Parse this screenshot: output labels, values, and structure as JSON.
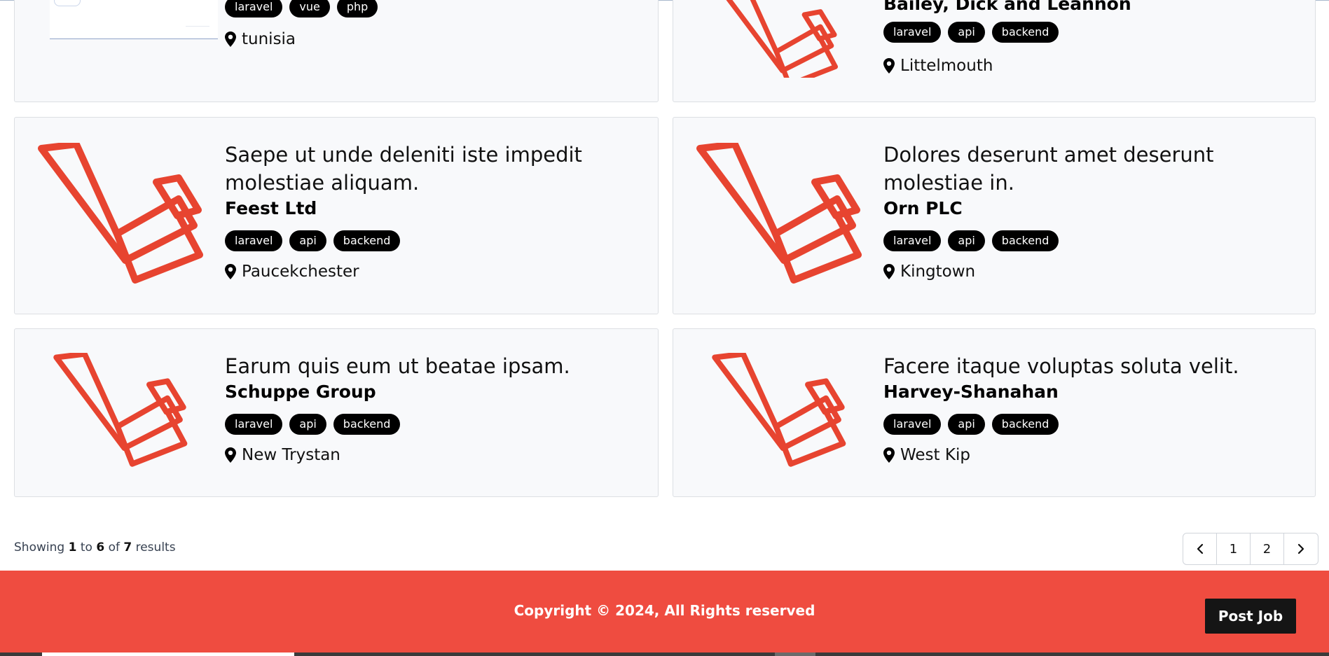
{
  "jobs": [
    {
      "title": "",
      "company": "",
      "tags": [
        "laravel",
        "vue",
        "php"
      ],
      "location": "tunisia",
      "logo": "screenshot-thumbnail"
    },
    {
      "title": "",
      "company": "Bailey, Dick and Leannon",
      "tags": [
        "laravel",
        "api",
        "backend"
      ],
      "location": "Littelmouth",
      "logo": "laravel-logo"
    },
    {
      "title": "Saepe ut unde deleniti iste impedit molestiae aliquam.",
      "company": "Feest Ltd",
      "tags": [
        "laravel",
        "api",
        "backend"
      ],
      "location": "Paucekchester",
      "logo": "laravel-logo"
    },
    {
      "title": "Dolores deserunt amet deserunt molestiae in.",
      "company": "Orn PLC",
      "tags": [
        "laravel",
        "api",
        "backend"
      ],
      "location": "Kingtown",
      "logo": "laravel-logo"
    },
    {
      "title": "Earum quis eum ut beatae ipsam.",
      "company": "Schuppe Group",
      "tags": [
        "laravel",
        "api",
        "backend"
      ],
      "location": "New Trystan",
      "logo": "laravel-logo"
    },
    {
      "title": "Facere itaque voluptas soluta velit.",
      "company": "Harvey-Shanahan",
      "tags": [
        "laravel",
        "api",
        "backend"
      ],
      "location": "West Kip",
      "logo": "laravel-logo"
    }
  ],
  "pagination": {
    "showing_prefix": "Showing",
    "from": "1",
    "to_word": "to",
    "to": "6",
    "of_word": "of",
    "total": "7",
    "results_word": "results",
    "prev_icon": "chevron-left-icon",
    "pages": [
      "1",
      "2"
    ],
    "next_icon": "chevron-right-icon"
  },
  "footer": {
    "copyright": "Copyright © 2024, All Rights reserved",
    "post_job_label": "Post Job"
  },
  "colors": {
    "brand_red": "#ef4c40",
    "laravel_red": "#e74430",
    "tag_bg": "#000000",
    "card_bg": "#f8f9fb"
  }
}
